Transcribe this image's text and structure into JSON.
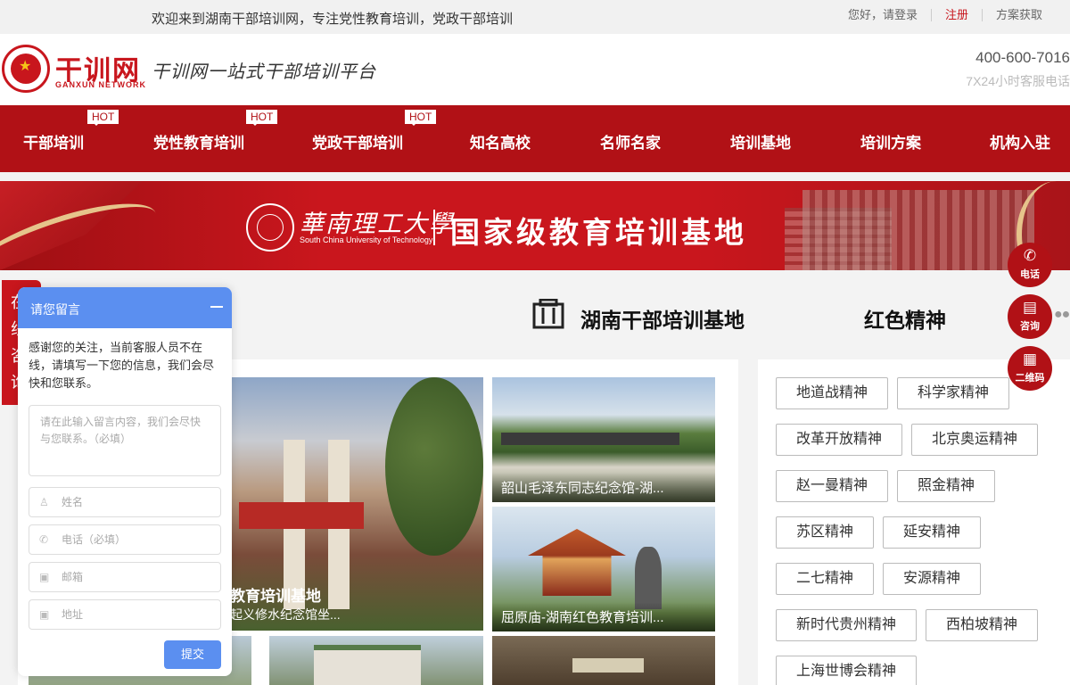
{
  "topbar": {
    "welcome": "欢迎来到湖南干部培训网，专注党性教育培训，党政干部培训",
    "login": "您好，请登录",
    "register": "注册",
    "proposal": "方案获取"
  },
  "header": {
    "logo_title": "干训网",
    "logo_sub": "GANXUN NETWORK",
    "slogan": "干训网一站式干部培训平台",
    "phone": "400-600-7016",
    "phone_note": "7X24小时客服电话"
  },
  "nav": {
    "items": [
      {
        "label": "干部培训",
        "hot": "HOT"
      },
      {
        "label": "党性教育培训",
        "hot": "HOT"
      },
      {
        "label": "党政干部培训",
        "hot": "HOT"
      },
      {
        "label": "知名高校"
      },
      {
        "label": "名师名家"
      },
      {
        "label": "培训基地"
      },
      {
        "label": "培训方案"
      },
      {
        "label": "机构入驻"
      }
    ]
  },
  "banner": {
    "university_cn": "華南理工大學",
    "university_en": "South China University of Technology",
    "title": "国家级教育培训基地"
  },
  "section": {
    "tab1": "湖南干部培训基地",
    "tab2": "红色精神"
  },
  "side": {
    "phone": "电话",
    "consult": "咨询",
    "qrcode": "二维码"
  },
  "consult_tab": {
    "chars": [
      "在",
      "线",
      "咨",
      "询"
    ]
  },
  "images": {
    "main_title": "教育培训基地",
    "main_sub": "起义修水纪念馆坐...",
    "cap2": "韶山毛泽东同志纪念馆-湖...",
    "cap3": "屈原庙-湖南红色教育培训..."
  },
  "tags": [
    "地道战精神",
    "科学家精神",
    "改革开放精神",
    "北京奥运精神",
    "赵一曼精神",
    "照金精神",
    "苏区精神",
    "延安精神",
    "二七精神",
    "安源精神",
    "新时代贵州精神",
    "西柏坡精神",
    "上海世博会精神"
  ],
  "message_widget": {
    "title": "请您留言",
    "intro": "感谢您的关注，当前客服人员不在线，请填写一下您的信息，我们会尽快和您联系。",
    "textarea_placeholder": "请在此输入留言内容，我们会尽快与您联系。（必填）",
    "name_placeholder": "姓名",
    "phone_placeholder": "电话（必填）",
    "email_placeholder": "邮箱",
    "address_placeholder": "地址",
    "submit": "提交"
  },
  "colors": {
    "brand_red": "#b11116",
    "widget_blue": "#5b8ff0"
  }
}
